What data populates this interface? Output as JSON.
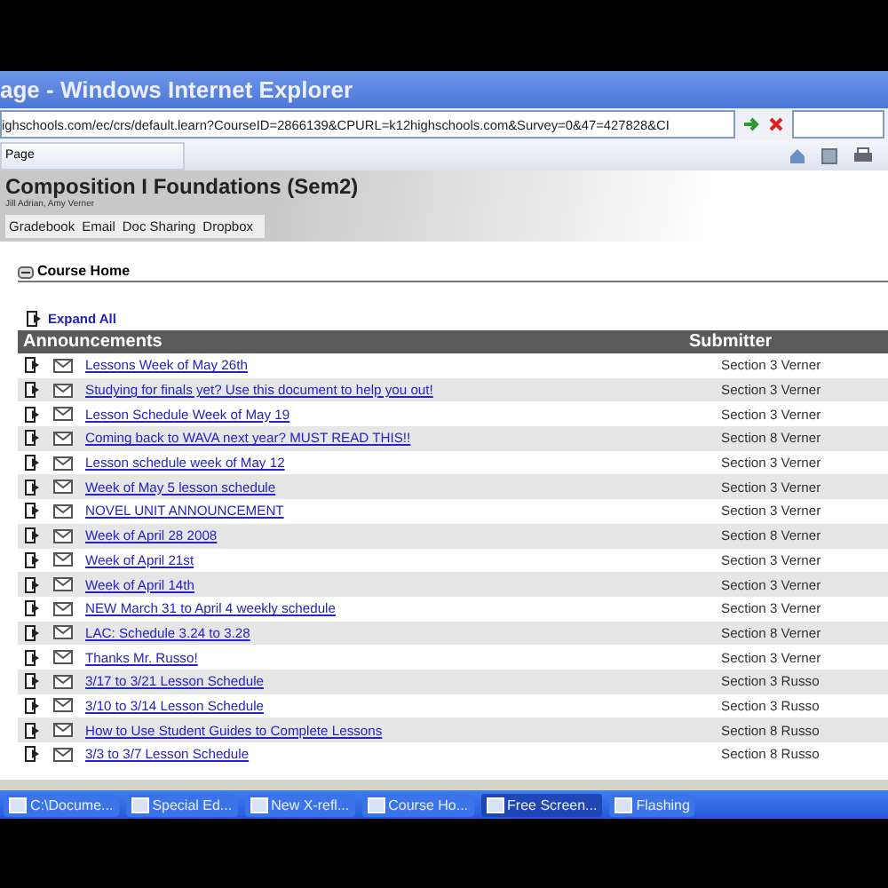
{
  "window": {
    "title": "age - Windows Internet Explorer"
  },
  "address_bar": {
    "value": "ighschools.com/ec/crs/default.learn?CourseID=2866139&CPURL=k12highschools.com&Survey=0&47=427828&CI"
  },
  "toolbar": {
    "page_menu": "Page"
  },
  "course": {
    "title": "Composition I Foundations (Sem2)",
    "instructors": "Jill Adrian, Amy Verner",
    "tabs": [
      "Gradebook",
      "Email",
      "Doc Sharing",
      "Dropbox"
    ]
  },
  "section": {
    "title": "Course Home",
    "expand_all": "Expand All"
  },
  "table": {
    "columns": [
      "Announcements",
      "Submitter"
    ],
    "rows": [
      {
        "title": "Lessons Week of May 26th",
        "submitter": "Section 3 Verner"
      },
      {
        "title": "Studying for finals yet? Use this document to help you out!",
        "submitter": "Section 3 Verner"
      },
      {
        "title": "Lesson Schedule Week of May 19",
        "submitter": "Section 3 Verner"
      },
      {
        "title": "Coming back to WAVA next year? MUST READ THIS!!",
        "submitter": "Section 8 Verner"
      },
      {
        "title": "Lesson schedule week of May 12",
        "submitter": "Section 3 Verner"
      },
      {
        "title": "Week of May 5 lesson schedule",
        "submitter": "Section 3 Verner"
      },
      {
        "title": "NOVEL UNIT ANNOUNCEMENT",
        "submitter": "Section 3 Verner"
      },
      {
        "title": "Week of April 28 2008",
        "submitter": "Section 8 Verner"
      },
      {
        "title": "Week of April 21st",
        "submitter": "Section 3 Verner"
      },
      {
        "title": "Week of April 14th",
        "submitter": "Section 3 Verner"
      },
      {
        "title": "NEW March 31 to April 4 weekly schedule",
        "submitter": "Section 3 Verner"
      },
      {
        "title": "LAC: Schedule 3.24 to 3.28",
        "submitter": "Section 8 Verner"
      },
      {
        "title": "Thanks Mr. Russo!",
        "submitter": "Section 3 Verner"
      },
      {
        "title": "3/17 to 3/21 Lesson Schedule",
        "submitter": "Section 3 Russo"
      },
      {
        "title": "3/10 to 3/14 Lesson Schedule",
        "submitter": "Section 3 Russo"
      },
      {
        "title": "How to Use Student Guides to Complete Lessons",
        "submitter": "Section 8 Russo"
      },
      {
        "title": "3/3 to 3/7 Lesson Schedule",
        "submitter": "Section 8 Russo"
      }
    ]
  },
  "taskbar": {
    "items": [
      {
        "label": "C:\\Docume...",
        "selected": false
      },
      {
        "label": "Special Ed...",
        "selected": false
      },
      {
        "label": "New X-refl...",
        "selected": false
      },
      {
        "label": "Course Ho...",
        "selected": false
      },
      {
        "label": "Free Screen...",
        "selected": true
      },
      {
        "label": "Flashing",
        "selected": false
      }
    ]
  }
}
